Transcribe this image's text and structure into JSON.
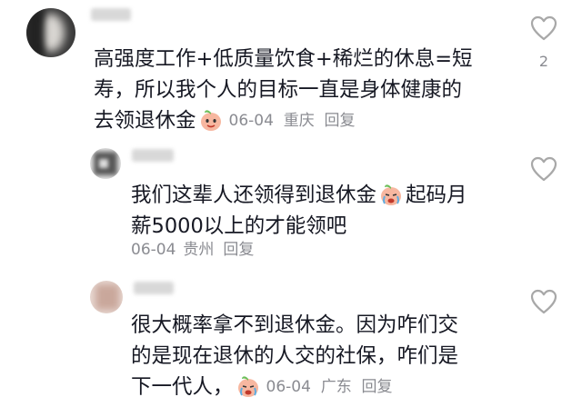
{
  "comments": [
    {
      "text_lines": [
        "高强度工作+低质量饮食+稀烂的休息=短",
        "寿，所以我个人的目标一直是身体健康的",
        "去领退休金"
      ],
      "date": "06-04",
      "location": "重庆",
      "reply_label": "回复",
      "like_count": "2",
      "emoji": "peach-emoji-icon"
    },
    {
      "text_lines": [
        "我们这辈人还领得到退休金",
        "起码月",
        "薪5000以上的才能领吧"
      ],
      "date": "06-04",
      "location": "贵州",
      "reply_label": "回复",
      "emoji": "peach-crying-emoji-icon"
    },
    {
      "text_lines": [
        "很大概率拿不到退休金。因为咋们交",
        "的是现在退休的人交的社保，咋们是",
        "下一代人，"
      ],
      "date": "06-04",
      "location": "广东",
      "reply_label": "回复",
      "emoji": "peach-crying-emoji-icon"
    }
  ],
  "colors": {
    "text": "#161823",
    "meta": "#8a8b91",
    "icon": "#a8a8a8"
  }
}
